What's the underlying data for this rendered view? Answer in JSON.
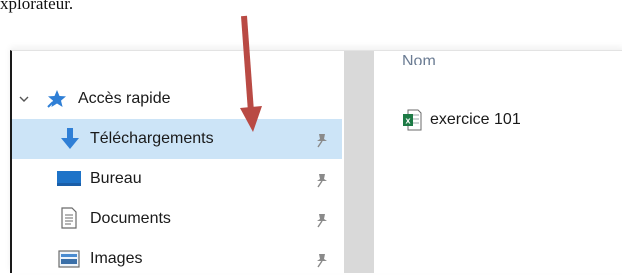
{
  "caption": "xplorateur.",
  "nav": {
    "items": [
      {
        "label": "Accès rapide",
        "icon": "star-pin-icon"
      },
      {
        "label": "Téléchargements",
        "icon": "download-arrow-icon",
        "pinned": true,
        "selected": true
      },
      {
        "label": "Bureau",
        "icon": "desktop-icon",
        "pinned": true
      },
      {
        "label": "Documents",
        "icon": "document-icon",
        "pinned": true
      },
      {
        "label": "Images",
        "icon": "picture-icon",
        "pinned": true
      }
    ]
  },
  "content": {
    "column_header": "Nom",
    "files": [
      {
        "name": "exercice 101",
        "icon": "excel-file-icon"
      }
    ]
  },
  "colors": {
    "selection": "#cce4f7",
    "arrow": "#b94a44",
    "star": "#2f7fd6"
  }
}
